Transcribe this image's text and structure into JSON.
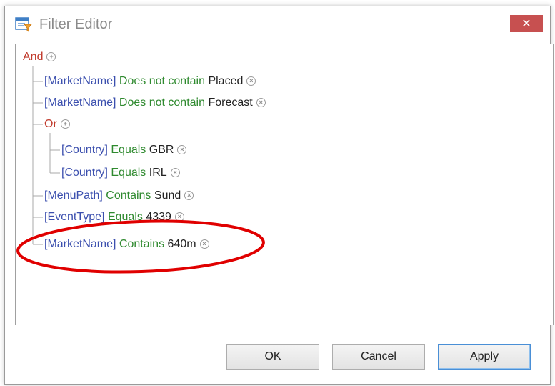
{
  "window": {
    "title": "Filter Editor",
    "close_label": "✕"
  },
  "tree": {
    "root": {
      "label": "And",
      "add_icon": "add-circle-icon"
    },
    "rows": [
      {
        "field": "[MarketName]",
        "op": "Does not contain",
        "value": "Placed"
      },
      {
        "field": "[MarketName]",
        "op": "Does not contain",
        "value": "Forecast"
      },
      {
        "group": "Or"
      },
      {
        "field": "[Country]",
        "op": "Equals",
        "value": "GBR"
      },
      {
        "field": "[Country]",
        "op": "Equals",
        "value": "IRL"
      },
      {
        "field": "[MenuPath]",
        "op": "Contains",
        "value": "Sund"
      },
      {
        "field": "[EventType]",
        "op": "Equals",
        "value": "4339"
      },
      {
        "field": "[MarketName]",
        "op": "Contains",
        "value": "640m"
      }
    ]
  },
  "buttons": {
    "ok": "OK",
    "cancel": "Cancel",
    "apply": "Apply"
  },
  "colors": {
    "group": "#c0392b",
    "field": "#3b4fae",
    "operator": "#2f8a2f",
    "close": "#c75050",
    "highlight": "#e00000"
  }
}
